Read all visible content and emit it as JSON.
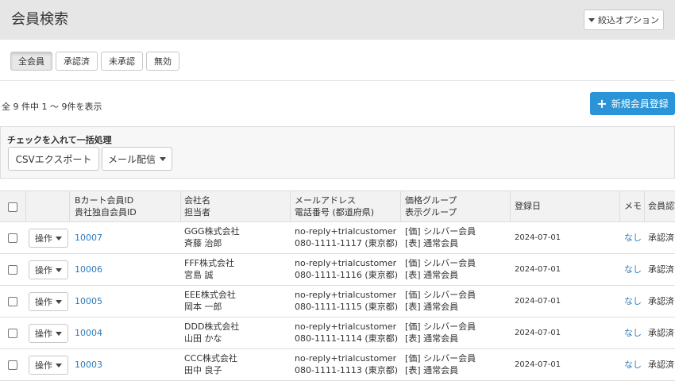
{
  "header": {
    "title": "会員検索",
    "filter_label": "絞込オプション"
  },
  "status_tabs": [
    {
      "label": "全会員",
      "active": true
    },
    {
      "label": "承認済",
      "active": false
    },
    {
      "label": "未承認",
      "active": false
    },
    {
      "label": "無効",
      "active": false
    }
  ],
  "count_text": "全 9 件中 1 ～ 9件を表示",
  "new_button_label": "新規会員登録",
  "bulk": {
    "title": "チェックを入れて一括処理",
    "csv_label": "CSVエクスポート",
    "mail_label": "メール配信"
  },
  "table": {
    "headers": {
      "id_line1": "Bカート会員ID",
      "id_line2": "貴社独自会員ID",
      "company_line1": "会社名",
      "company_line2": "担当者",
      "contact_line1": "メールアドレス",
      "contact_line2": "電話番号 (都道府県)",
      "group_line1": "価格グループ",
      "group_line2": "表示グループ",
      "date": "登録日",
      "memo": "メモ",
      "approval": "会員認証"
    },
    "op_label": "操作",
    "rows": [
      {
        "id": "10007",
        "company": "GGG株式会社",
        "person": "斉藤 治郎",
        "email": "no-reply+trialcustomer…",
        "phone": "080-1111-1117 (東京都)",
        "price_group": "[価] シルバー会員",
        "display_group": "[表] 通常会員",
        "date": "2024-07-01",
        "memo": "なし",
        "approval": "承認済"
      },
      {
        "id": "10006",
        "company": "FFF株式会社",
        "person": "宮島 誠",
        "email": "no-reply+trialcustomer…",
        "phone": "080-1111-1116 (東京都)",
        "price_group": "[価] シルバー会員",
        "display_group": "[表] 通常会員",
        "date": "2024-07-01",
        "memo": "なし",
        "approval": "承認済"
      },
      {
        "id": "10005",
        "company": "EEE株式会社",
        "person": "岡本 一郎",
        "email": "no-reply+trialcustomer…",
        "phone": "080-1111-1115 (東京都)",
        "price_group": "[価] シルバー会員",
        "display_group": "[表] 通常会員",
        "date": "2024-07-01",
        "memo": "なし",
        "approval": "承認済"
      },
      {
        "id": "10004",
        "company": "DDD株式会社",
        "person": "山田 かな",
        "email": "no-reply+trialcustomer…",
        "phone": "080-1111-1114 (東京都)",
        "price_group": "[価] シルバー会員",
        "display_group": "[表] 通常会員",
        "date": "2024-07-01",
        "memo": "なし",
        "approval": "承認済"
      },
      {
        "id": "10003",
        "company": "CCC株式会社",
        "person": "田中 良子",
        "email": "no-reply+trialcustomer…",
        "phone": "080-1111-1113 (東京都)",
        "price_group": "[価] シルバー会員",
        "display_group": "[表] 通常会員",
        "date": "2024-07-01",
        "memo": "なし",
        "approval": "承認済"
      }
    ]
  },
  "colors": {
    "accent": "#2b94d6",
    "link": "#2b7bbf",
    "header_bg": "#e6e6e6"
  }
}
